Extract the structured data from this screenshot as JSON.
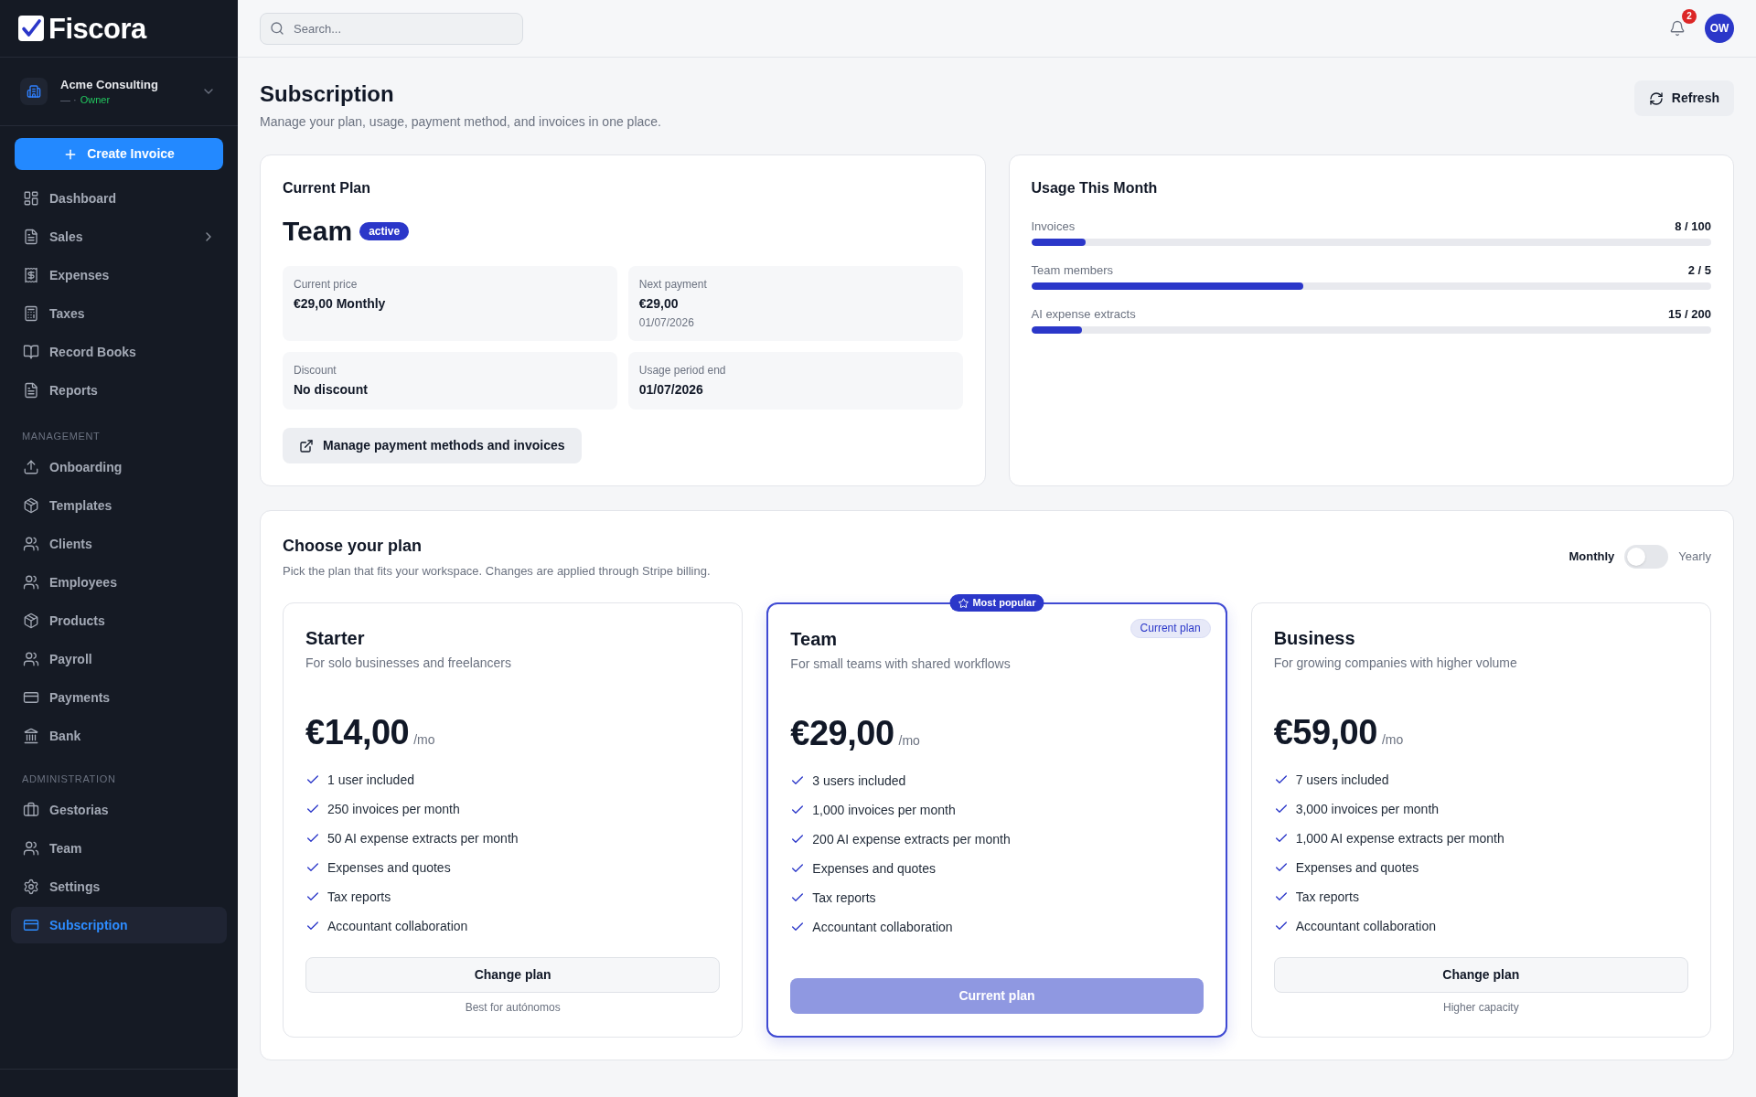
{
  "sidebar": {
    "logo": "Fiscora",
    "workspace": {
      "name": "Acme Consulting",
      "detail": "— ·",
      "role": "Owner"
    },
    "create_button": "Create Invoice",
    "nav": [
      {
        "label": "Dashboard",
        "selected": false
      },
      {
        "label": "Sales",
        "selected": false,
        "expanded": false
      },
      {
        "label": "Expenses",
        "selected": false
      },
      {
        "label": "Taxes",
        "selected": false
      },
      {
        "label": "Record Books",
        "selected": false
      },
      {
        "label": "Reports",
        "selected": false
      }
    ],
    "sections": [
      {
        "title": "MANAGEMENT",
        "items": [
          {
            "label": "Onboarding",
            "selected": false
          },
          {
            "label": "Templates",
            "selected": false
          },
          {
            "label": "Clients",
            "selected": false
          },
          {
            "label": "Employees",
            "selected": false
          },
          {
            "label": "Products",
            "selected": false
          },
          {
            "label": "Payroll",
            "selected": false
          },
          {
            "label": "Payments",
            "selected": false
          },
          {
            "label": "Bank",
            "selected": false
          }
        ]
      },
      {
        "title": "ADMINISTRATION",
        "items": [
          {
            "label": "Gestorias",
            "selected": false
          },
          {
            "label": "Team",
            "selected": false
          },
          {
            "label": "Settings",
            "selected": false
          },
          {
            "label": "Subscription",
            "selected": true
          }
        ]
      }
    ]
  },
  "header": {
    "search": {
      "placeholder": "Search..."
    },
    "notifications": "2",
    "avatar": "OW"
  },
  "page": {
    "title": "Subscription",
    "subtitle": "Manage your plan, usage, payment method, and invoices in one place.",
    "refresh_button": "Refresh"
  },
  "current_plan": {
    "title": "Current Plan",
    "plan": "Team",
    "status": "active",
    "details": [
      {
        "label": "Current price",
        "value": "€29,00 Monthly"
      },
      {
        "label": "Next payment",
        "value": "€29,00",
        "note": "01/07/2026"
      },
      {
        "label": "Discount",
        "value": "No discount"
      },
      {
        "label": "Usage period end",
        "value": "01/07/2026"
      }
    ],
    "manage_button": "Manage payment methods and invoices"
  },
  "usage": {
    "title": "Usage This Month",
    "meters": [
      {
        "label": "Invoices",
        "reading": "8 / 100",
        "level": 0.08
      },
      {
        "label": "Team members",
        "reading": "2 / 5",
        "level": 0.4
      },
      {
        "label": "AI expense extracts",
        "reading": "15 / 200",
        "level": 0.075
      }
    ]
  },
  "plans_section": {
    "title": "Choose your plan",
    "subtitle": "Pick the plan that fits your workspace. Changes are applied through Stripe billing.",
    "billing": {
      "monthly_label": "Monthly",
      "yearly_label": "Yearly",
      "yearly": false
    },
    "plans": [
      {
        "name": "Starter",
        "description": "For solo businesses and freelancers",
        "price": "€14,00",
        "period": "/mo",
        "features": [
          "1 user included",
          "250 invoices per month",
          "50 AI expense extracts per month",
          "Expenses and quotes",
          "Tax reports",
          "Accountant collaboration"
        ],
        "button": {
          "label": "Change plan",
          "disabled": false
        },
        "note": "Best for autónomos",
        "selected": false
      },
      {
        "name": "Team",
        "badge": "Most popular",
        "tag": "Current plan",
        "description": "For small teams with shared workflows",
        "price": "€29,00",
        "period": "/mo",
        "features": [
          "3 users included",
          "1,000 invoices per month",
          "200 AI expense extracts per month",
          "Expenses and quotes",
          "Tax reports",
          "Accountant collaboration"
        ],
        "button": {
          "label": "Current plan",
          "disabled": true
        },
        "selected": true
      },
      {
        "name": "Business",
        "description": "For growing companies with higher volume",
        "price": "€59,00",
        "period": "/mo",
        "features": [
          "7 users included",
          "3,000 invoices per month",
          "1,000 AI expense extracts per month",
          "Expenses and quotes",
          "Tax reports",
          "Accountant collaboration"
        ],
        "button": {
          "label": "Change plan",
          "disabled": false
        },
        "note": "Higher capacity",
        "selected": false
      }
    ]
  }
}
